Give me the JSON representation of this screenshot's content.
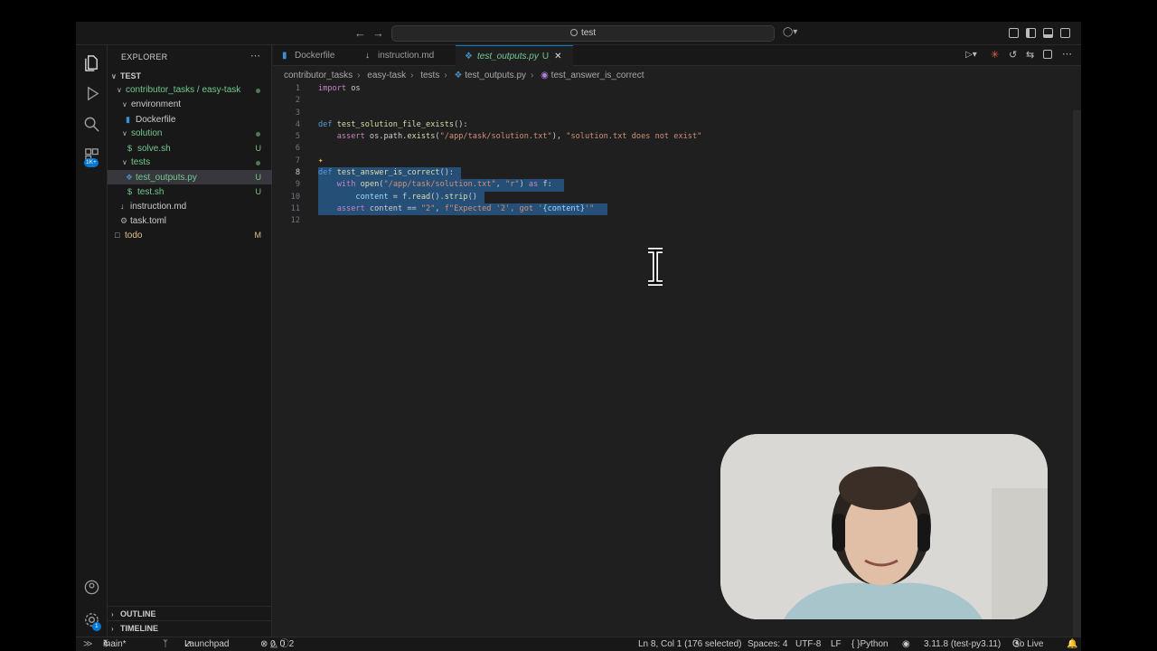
{
  "titlebar": {
    "search": "test",
    "back_icon": "arrow-left-icon",
    "forward_icon": "arrow-right-icon"
  },
  "explorer": {
    "title": "EXPLORER",
    "root": "TEST",
    "items": [
      {
        "label": "contributor_tasks / easy-task",
        "badge": "",
        "kind": "folder"
      },
      {
        "label": "environment",
        "badge": "",
        "kind": "folder"
      },
      {
        "label": "Dockerfile",
        "badge": "",
        "kind": "file"
      },
      {
        "label": "solution",
        "badge": "",
        "kind": "folder"
      },
      {
        "label": "solve.sh",
        "badge": "U",
        "kind": "file"
      },
      {
        "label": "tests",
        "badge": "",
        "kind": "folder"
      },
      {
        "label": "test_outputs.py",
        "badge": "U",
        "kind": "file"
      },
      {
        "label": "test.sh",
        "badge": "U",
        "kind": "file"
      },
      {
        "label": "instruction.md",
        "badge": "",
        "kind": "file"
      },
      {
        "label": "task.toml",
        "badge": "",
        "kind": "file"
      },
      {
        "label": "todo",
        "badge": "M",
        "kind": "file"
      }
    ],
    "outline": "OUTLINE",
    "timeline": "TIMELINE",
    "extensions_badge": "1K+",
    "settings_badge": "1"
  },
  "tabs": [
    {
      "label": "Dockerfile"
    },
    {
      "label": "instruction.md"
    },
    {
      "label": "test_outputs.py",
      "badge": "U"
    }
  ],
  "breadcrumb": [
    "contributor_tasks",
    "easy-task",
    "tests",
    "test_outputs.py",
    "test_answer_is_correct"
  ],
  "code": {
    "line_numbers": [
      "1",
      "2",
      "3",
      "4",
      "5",
      "6",
      "7",
      "8",
      "9",
      "10",
      "11",
      "12"
    ],
    "l1_kw": "import",
    "l1_rest": " os",
    "l4_kw": "def",
    "l4_fn": "test_solution_file_exists",
    "l4_rest": "():",
    "l5_kw": "assert",
    "l5_a": " os.path.",
    "l5_fn": "exists",
    "l5_b": "(",
    "l5_str1": "\"/app/task/solution.txt\"",
    "l5_c": "), ",
    "l5_str2": "\"solution.txt does not exist\"",
    "l8_kw": "def",
    "l8_fn": "test_answer_is_correct",
    "l8_rest": "():",
    "l9_kw": "with",
    "l9_fn": "open",
    "l9_a": "(",
    "l9_str1": "\"/app/task/solution.txt\"",
    "l9_b": ", ",
    "l9_str2": "\"r\"",
    "l9_c": ") ",
    "l9_kw2": "as",
    "l9_d": " f:",
    "l10_var": "content",
    "l10_a": " = f.",
    "l10_fn": "read",
    "l10_b": "().",
    "l10_fn2": "strip",
    "l10_c": "()",
    "l11_kw": "assert",
    "l11_a": " content == ",
    "l11_str1": "\"2\"",
    "l11_b": ", ",
    "l11_str2": "f\"Expected '2', got '",
    "l11_var": "{content}",
    "l11_str3": "'\""
  },
  "status": {
    "branch": "main*",
    "launchpad": "Launchpad",
    "problems": "0",
    "warnings": "0",
    "info": "2",
    "cursor": "Ln 8, Col 1 (176 selected)",
    "spaces": "Spaces: 4",
    "encoding": "UTF-8",
    "eol": "LF",
    "language": "Python",
    "interpreter": "3.11.8 (test-py3.11)",
    "golive": "Go Live"
  }
}
